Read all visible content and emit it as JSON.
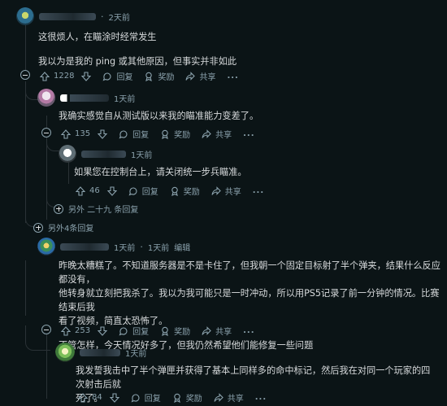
{
  "comments": [
    {
      "time": "2天前",
      "lines": [
        "这很烦人，在瞄涂时经常发生",
        "我以为是我的 ping 或其他原因，但事实并非如此"
      ],
      "votes": "1228",
      "reply": "回复",
      "award": "奖励",
      "share": "共享",
      "more": "..."
    },
    {
      "time": "1天前",
      "lines": [
        "我确实感觉自从测试版以来我的瞄准能力变差了。"
      ],
      "votes": "135",
      "reply": "回复",
      "award": "奖励",
      "share": "共享",
      "more": "..."
    },
    {
      "time": "1天前",
      "lines": [
        "如果您在控制台上，请关闭统一步兵瞄准。"
      ],
      "votes": "46",
      "reply": "回复",
      "award": "奖励",
      "share": "共享",
      "more": "...",
      "more_replies": "另外 二十九 条回复"
    },
    {
      "more_replies": "另外4条回复"
    },
    {
      "time": "1天前",
      "time2": "1天前",
      "edited": "编辑",
      "lines": [
        "昨晚太糟糕了。不知道服务器是不是卡住了，但我朝一个固定目标射了半个弹夹，结果什么反应都没有，",
        "他转身就立刻把我杀了。我以为我可能只是一时冲动，所以用PS5记录了前一分钟的情况。比赛结束后我",
        "看了视频，简直太恐怖了。",
        "不管怎样，今天情况好多了，但我仍然希望他们能修复一些问题"
      ],
      "votes": "253",
      "reply": "回复",
      "award": "奖励",
      "share": "共享",
      "more": "..."
    },
    {
      "time": "1天前",
      "lines": [
        "我发誓我击中了半个弹匣并获得了基本上同样多的命中标记，然后我在对同一个玩家的四次射击后就",
        "死了。"
      ],
      "votes": "84",
      "reply": "回复",
      "award": "奖励",
      "share": "共享",
      "more": "..."
    }
  ],
  "colors": {
    "bg": "#0b1416",
    "text": "#d7dadc",
    "muted": "#8ba2ad",
    "line": "#2a3236"
  },
  "icons": [
    "avatar",
    "upvote-icon",
    "downvote-icon",
    "reply-icon",
    "award-icon",
    "share-icon",
    "collapse-icon",
    "expand-icon"
  ]
}
